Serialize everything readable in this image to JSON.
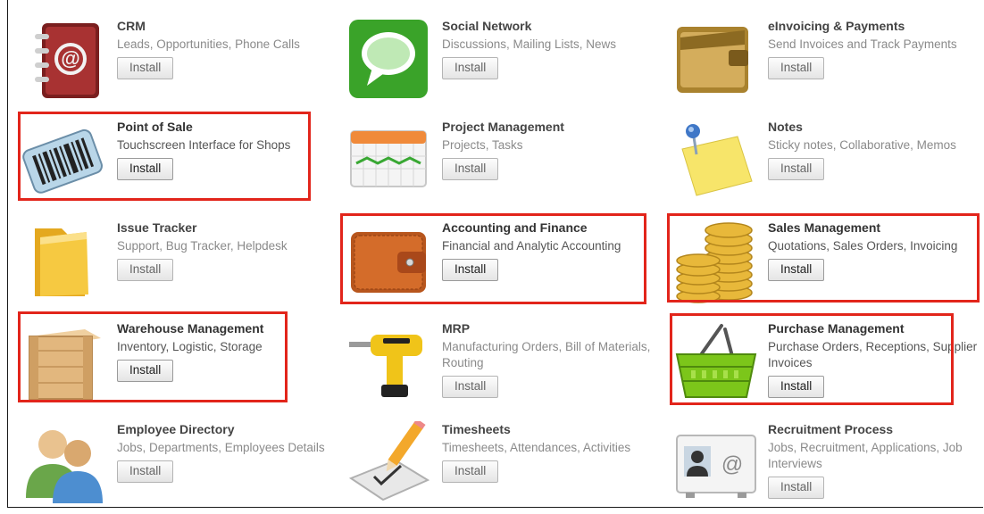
{
  "apps": {
    "crm": {
      "title": "CRM",
      "desc": "Leads, Opportunities, Phone Calls",
      "btn": "Install",
      "icon": "address-book-icon"
    },
    "social": {
      "title": "Social Network",
      "desc": "Discussions, Mailing Lists, News",
      "btn": "Install",
      "icon": "speech-bubble-icon"
    },
    "einvoicing": {
      "title": "eInvoicing & Payments",
      "desc": "Send Invoices and Track Payments",
      "btn": "Install",
      "icon": "wallet-icon"
    },
    "pos": {
      "title": "Point of Sale",
      "desc": "Touchscreen Interface for Shops",
      "btn": "Install",
      "icon": "barcode-scanner-icon"
    },
    "project": {
      "title": "Project Management",
      "desc": "Projects, Tasks",
      "btn": "Install",
      "icon": "gantt-calendar-icon"
    },
    "notes": {
      "title": "Notes",
      "desc": "Sticky notes, Collaborative, Memos",
      "btn": "Install",
      "icon": "sticky-note-icon"
    },
    "issue": {
      "title": "Issue Tracker",
      "desc": "Support, Bug Tracker, Helpdesk",
      "btn": "Install",
      "icon": "folder-icon"
    },
    "accounting": {
      "title": "Accounting and Finance",
      "desc": "Financial and Analytic Accounting",
      "btn": "Install",
      "icon": "leather-wallet-icon"
    },
    "sales": {
      "title": "Sales Management",
      "desc": "Quotations, Sales Orders, Invoicing",
      "btn": "Install",
      "icon": "coins-icon"
    },
    "warehouse": {
      "title": "Warehouse Management",
      "desc": "Inventory, Logistic, Storage",
      "btn": "Install",
      "icon": "wooden-crate-icon"
    },
    "mrp": {
      "title": "MRP",
      "desc": "Manufacturing Orders, Bill of Materials, Routing",
      "btn": "Install",
      "icon": "power-drill-icon"
    },
    "purchase": {
      "title": "Purchase Management",
      "desc": "Purchase Orders, Receptions, Supplier Invoices",
      "btn": "Install",
      "icon": "shopping-basket-icon"
    },
    "employee": {
      "title": "Employee Directory",
      "desc": "Jobs, Departments, Employees Details",
      "btn": "Install",
      "icon": "people-icon"
    },
    "timesheets": {
      "title": "Timesheets",
      "desc": "Timesheets, Attendances, Activities",
      "btn": "Install",
      "icon": "pencil-paper-icon"
    },
    "recruitment": {
      "title": "Recruitment Process",
      "desc": "Jobs, Recruitment, Applications, Job Interviews",
      "btn": "Install",
      "icon": "contact-card-icon"
    }
  },
  "colors": {
    "highlight": "#e2251b",
    "title_text": "#444444",
    "desc_text": "#8a8a8a"
  }
}
